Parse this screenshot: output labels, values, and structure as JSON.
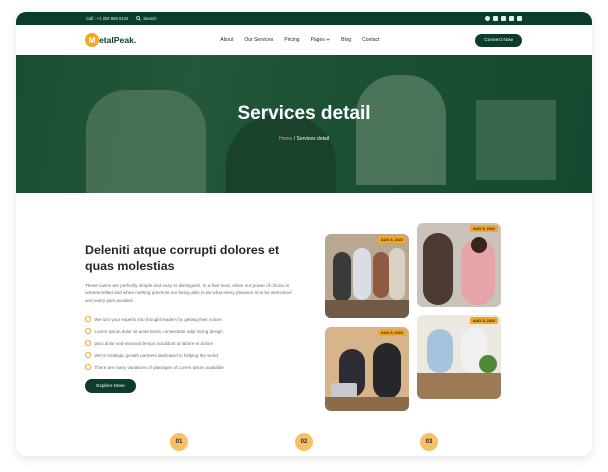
{
  "topbar": {
    "call": "Call : +1 202 555 0124",
    "search_label": "Search"
  },
  "navbar": {
    "logo_mark": "M",
    "logo_text": "etalPeak.",
    "items": [
      "About",
      "Our Services",
      "Pricing",
      "Pages",
      "Blog",
      "Contact"
    ],
    "cta": "Connect Now"
  },
  "hero": {
    "title": "Services detail",
    "breadcrumb_home": "Home",
    "breadcrumb_current": " / Services detail"
  },
  "content": {
    "title": "Deleniti atque corrupti dolores et quas molestias",
    "description": "These cases are perfectly simple and easy to distinguish. In a free hour, when our power of choice is untrammelled and when nothing prevents our being able to do what every pleasure is to be welcomed and every pain avoided.",
    "checklist": [
      "We turn your experts into thought leaders by getting their voices",
      "Lorem ipsum dolor sit amet lorem consectetur adip iscing design",
      "pisci dolor sed eiusmod tempo incididunt ut labore et dolore",
      "We're strategic growth partners dedicated to helping the world",
      "There are many variations of passages of Lorem Ipsum available"
    ],
    "button": "Explore More"
  },
  "cards": [
    {
      "date": "AUG 5, 2022"
    },
    {
      "date": "AUG 5, 2022"
    },
    {
      "date": "AUG 5, 2022"
    },
    {
      "date": "AUG 5, 2022"
    }
  ],
  "steps": [
    "01",
    "02",
    "03"
  ],
  "colors": {
    "primary": "#0c3d2a",
    "accent": "#f5a623"
  }
}
